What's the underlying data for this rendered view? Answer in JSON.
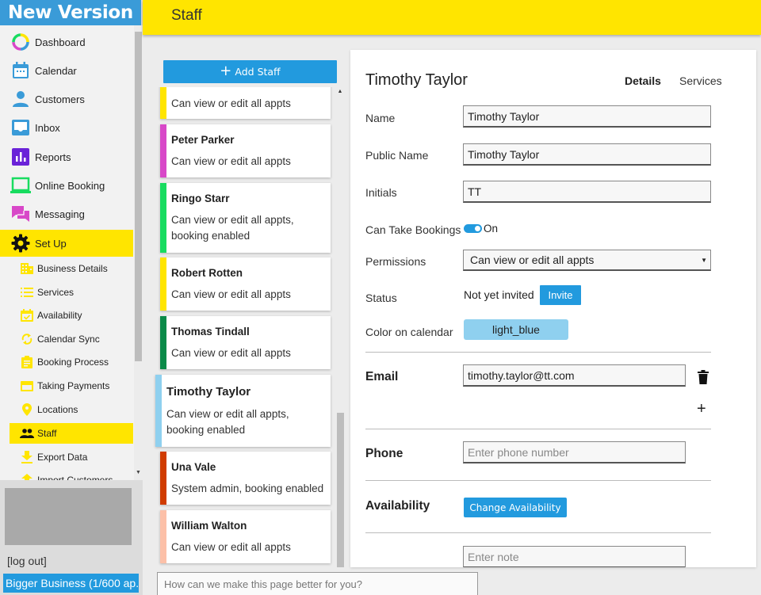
{
  "app": {
    "brand": "New Version",
    "page_title": "Staff"
  },
  "sidebar": {
    "items": [
      {
        "label": "Dashboard",
        "icon": "dashboard-ring-icon"
      },
      {
        "label": "Calendar",
        "icon": "calendar-icon"
      },
      {
        "label": "Customers",
        "icon": "person-icon"
      },
      {
        "label": "Inbox",
        "icon": "inbox-icon"
      },
      {
        "label": "Reports",
        "icon": "bar-chart-icon"
      },
      {
        "label": "Online Booking",
        "icon": "laptop-icon"
      },
      {
        "label": "Messaging",
        "icon": "chat-icon"
      },
      {
        "label": "Set Up",
        "icon": "gear-icon",
        "active": true
      }
    ],
    "sub_items": [
      {
        "label": "Business Details",
        "icon": "building-icon"
      },
      {
        "label": "Services",
        "icon": "list-icon"
      },
      {
        "label": "Availability",
        "icon": "calendar-check-icon"
      },
      {
        "label": "Calendar Sync",
        "icon": "sync-icon"
      },
      {
        "label": "Booking Process",
        "icon": "clipboard-icon"
      },
      {
        "label": "Taking Payments",
        "icon": "credit-card-icon"
      },
      {
        "label": "Locations",
        "icon": "location-pin-icon"
      },
      {
        "label": "Staff",
        "icon": "people-icon",
        "active": true
      },
      {
        "label": "Export Data",
        "icon": "download-icon"
      },
      {
        "label": "Import Customers",
        "icon": "upload-icon"
      }
    ],
    "logout_label": "[log out]",
    "business_label": "Bigger Business (1/600 ap..."
  },
  "staff_list": {
    "add_label": "Add Staff",
    "staff": [
      {
        "name": "",
        "description": "Can view or edit all appts",
        "color": "#ffe500"
      },
      {
        "name": "Peter Parker",
        "description": "Can view or edit all appts",
        "color": "#d848c8"
      },
      {
        "name": "Ringo Starr",
        "description": "Can view or edit all appts, booking enabled",
        "color": "#18dc60"
      },
      {
        "name": "Robert Rotten",
        "description": "Can view or edit all appts",
        "color": "#ffe500"
      },
      {
        "name": "Thomas Tindall",
        "description": "Can view or edit all appts",
        "color": "#0a8a48"
      },
      {
        "name": "Timothy Taylor",
        "description": "Can view or edit all appts, booking enabled",
        "color": "#8fd0ef",
        "selected": true
      },
      {
        "name": "Una Vale",
        "description": "System admin, booking enabled",
        "color": "#d03c00"
      },
      {
        "name": "William Walton",
        "description": "Can view or edit all appts",
        "color": "#fcc0a8"
      }
    ]
  },
  "detail": {
    "title": "Timothy Taylor",
    "tabs": [
      {
        "label": "Details",
        "active": true
      },
      {
        "label": "Services",
        "active": false
      }
    ],
    "fields": {
      "name_label": "Name",
      "name_value": "Timothy Taylor",
      "public_name_label": "Public Name",
      "public_name_value": "Timothy Taylor",
      "initials_label": "Initials",
      "initials_value": "TT",
      "bookings_label": "Can Take Bookings",
      "bookings_state": "On",
      "bookings_on": true,
      "permissions_label": "Permissions",
      "permissions_value": "Can view or edit all appts",
      "status_label": "Status",
      "status_value": "Not yet invited",
      "invite_label": "Invite",
      "color_label": "Color on calendar",
      "color_value": "light_blue",
      "color_hex": "#8fd0ef"
    },
    "email": {
      "label": "Email",
      "value": "timothy.taylor@tt.com"
    },
    "phone": {
      "label": "Phone",
      "placeholder": "Enter phone number"
    },
    "availability": {
      "label": "Availability",
      "button_label": "Change Availability"
    },
    "note": {
      "placeholder": "Enter note"
    }
  },
  "feedback": {
    "placeholder": "How can we make this page better for you?"
  },
  "colors": {
    "accent_blue": "#229ade",
    "brand_blue": "#3a9bd8",
    "highlight_yellow": "#ffe500"
  }
}
